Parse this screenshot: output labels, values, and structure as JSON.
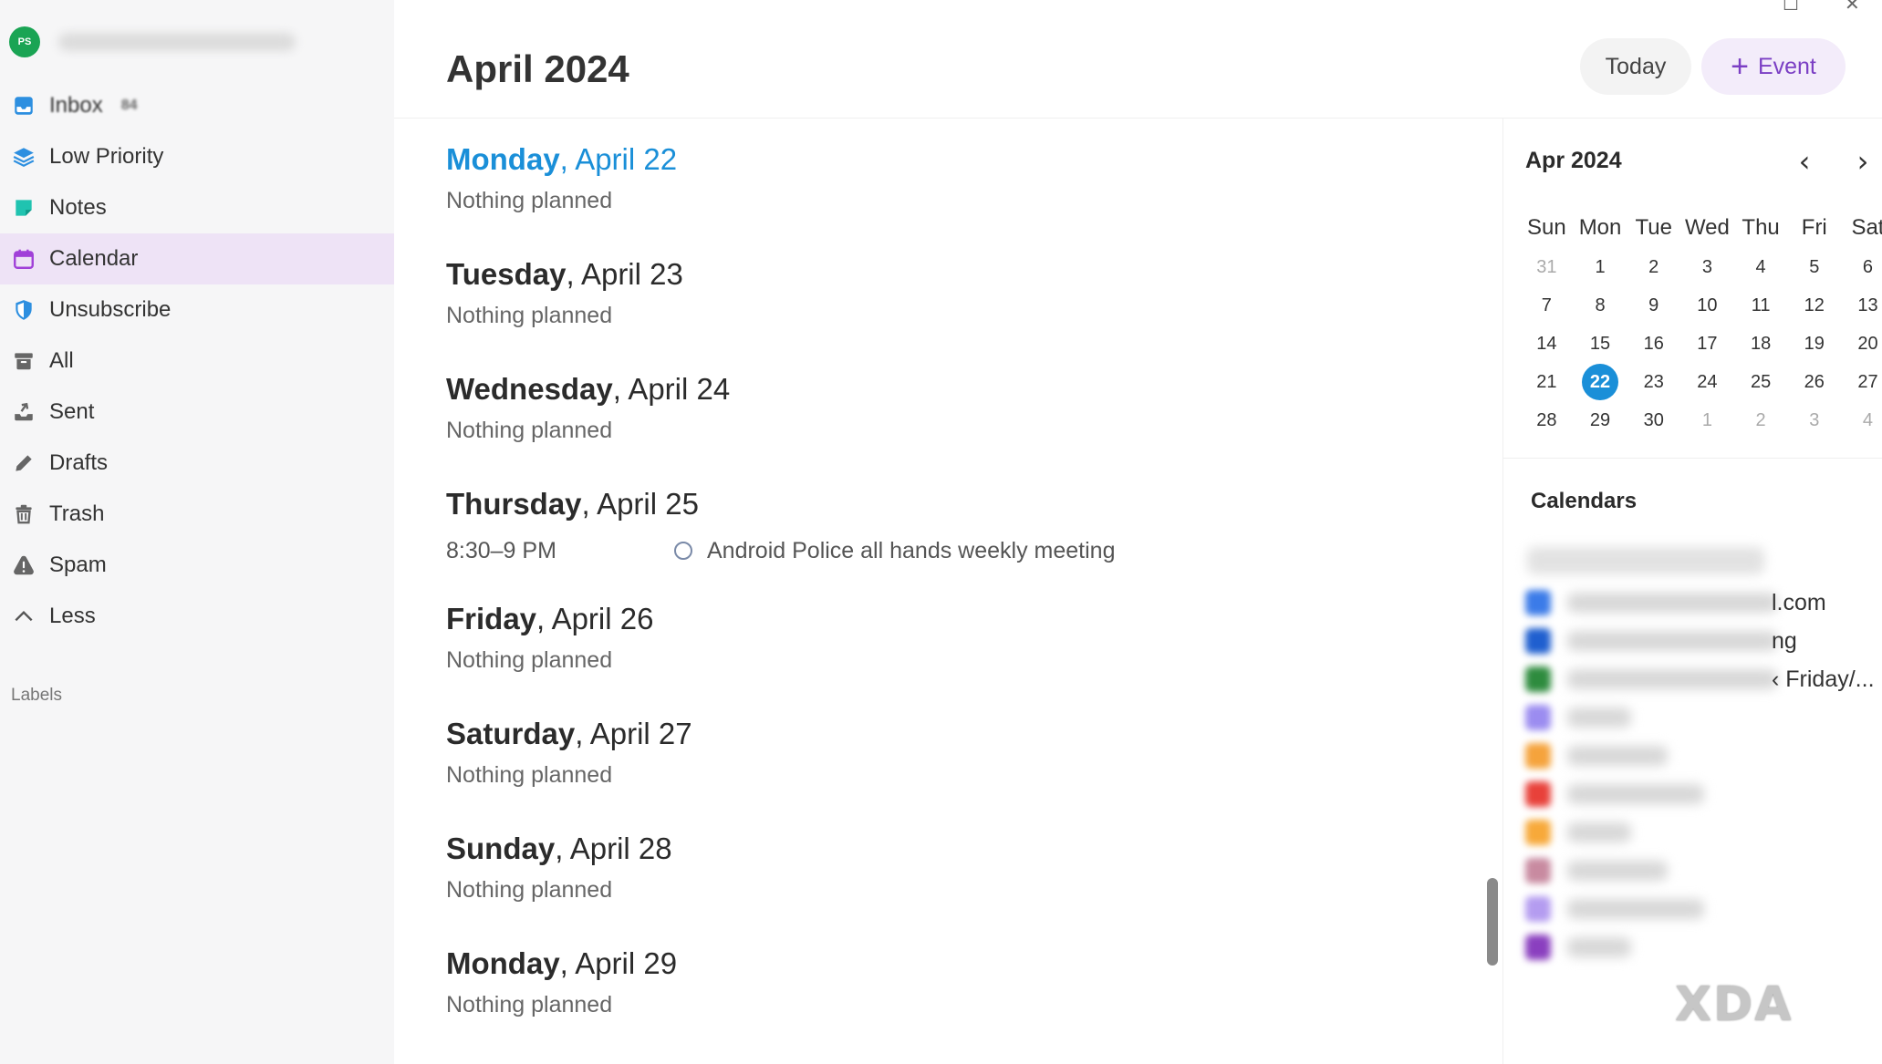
{
  "account": {
    "avatar_initials": "PS"
  },
  "sidebar": {
    "items": [
      {
        "label": "Inbox",
        "badge": "84",
        "icon": "inbox-icon"
      },
      {
        "label": "Low Priority",
        "icon": "layers-icon"
      },
      {
        "label": "Notes",
        "icon": "note-icon"
      },
      {
        "label": "Calendar",
        "icon": "calendar-icon"
      },
      {
        "label": "Unsubscribe",
        "icon": "shield-icon"
      },
      {
        "label": "All",
        "icon": "archive-icon"
      },
      {
        "label": "Sent",
        "icon": "send-icon"
      },
      {
        "label": "Drafts",
        "icon": "pencil-icon"
      },
      {
        "label": "Trash",
        "icon": "trash-icon"
      },
      {
        "label": "Spam",
        "icon": "warning-icon"
      },
      {
        "label": "Less",
        "icon": "chevron-up-icon"
      }
    ],
    "labels_heading": "Labels"
  },
  "header": {
    "title": "April 2024",
    "today_label": "Today",
    "event_label": "Event"
  },
  "agenda": {
    "days": [
      {
        "weekday": "Monday",
        "date": ", April 22",
        "text": "Nothing planned"
      },
      {
        "weekday": "Tuesday",
        "date": ", April 23",
        "text": "Nothing planned"
      },
      {
        "weekday": "Wednesday",
        "date": ", April 24",
        "text": "Nothing planned"
      },
      {
        "weekday": "Thursday",
        "date": ", April 25",
        "event_time": "8:30–9 PM",
        "event_title": "Android Police all hands weekly meeting"
      },
      {
        "weekday": "Friday",
        "date": ", April 26",
        "text": "Nothing planned"
      },
      {
        "weekday": "Saturday",
        "date": ", April 27",
        "text": "Nothing planned"
      },
      {
        "weekday": "Sunday",
        "date": ", April 28",
        "text": "Nothing planned"
      },
      {
        "weekday": "Monday",
        "date": ", April 29",
        "text": "Nothing planned"
      }
    ]
  },
  "mini_calendar": {
    "title": "Apr 2024",
    "weekdays": [
      "Sun",
      "Mon",
      "Tue",
      "Wed",
      "Thu",
      "Fri",
      "Sat"
    ],
    "days": [
      "31",
      "1",
      "2",
      "3",
      "4",
      "5",
      "6",
      "7",
      "8",
      "9",
      "10",
      "11",
      "12",
      "13",
      "14",
      "15",
      "16",
      "17",
      "18",
      "19",
      "20",
      "21",
      "22",
      "23",
      "24",
      "25",
      "26",
      "27",
      "28",
      "29",
      "30",
      "1",
      "2",
      "3",
      "4"
    ],
    "selected": "22"
  },
  "calendars": {
    "heading": "Calendars",
    "items": [
      {
        "tail": "l.com",
        "color": "#3b7be8"
      },
      {
        "tail": "ng",
        "color": "#1f5fcf"
      },
      {
        "tail": "‹ Friday/...",
        "color": "#2e8b3e"
      },
      {
        "tail": "",
        "color": "#9b8cf0"
      },
      {
        "tail": "",
        "color": "#f5a33c"
      },
      {
        "tail": "",
        "color": "#e8413a"
      },
      {
        "tail": "",
        "color": "#f7a93a"
      },
      {
        "tail": "",
        "color": "#c88aa0"
      },
      {
        "tail": "",
        "color": "#b49cf0"
      },
      {
        "tail": "",
        "color": "#8a3fbf"
      }
    ]
  },
  "watermark": "XDA",
  "colors": {
    "accent": "#1a8fd8",
    "purple": "#7b3fc4",
    "active_bg": "#eee3f6"
  }
}
